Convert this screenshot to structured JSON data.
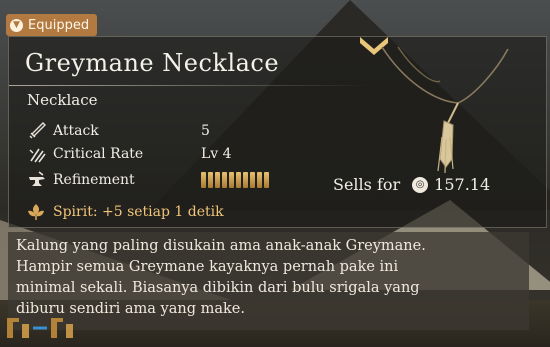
{
  "tag": {
    "label": "Equipped",
    "icon": "equipped-shield-icon"
  },
  "item": {
    "name": "Greymane Necklace",
    "type": "Necklace",
    "icon": "necklace-art"
  },
  "stats": [
    {
      "name": "Attack",
      "value": "5",
      "icon": "sword-icon"
    },
    {
      "name": "Critical Rate",
      "value": "Lv 4",
      "icon": "crit-slash-icon"
    },
    {
      "name": "Refinement",
      "value": "",
      "icon": "anvil-icon"
    }
  ],
  "refinement": {
    "level": 10,
    "max": 10
  },
  "sell": {
    "label": "Sells for",
    "price": "157.14",
    "currency_icon": "coin-icon"
  },
  "spirit": {
    "text": "Spirit: +5 setiap 1 detik",
    "icon": "spirit-leaf-icon"
  },
  "description": [
    "Kalung yang paling disukain ama anak-anak Greymane.",
    "Hampir semua Greymane kayaknya pernah pake ini",
    "minimal sekali. Biasanya dibikin dari bulu srigala yang",
    "diburu sendiri ama yang make."
  ],
  "colors": {
    "accent": "#b27a40",
    "spirit": "#f1c57a",
    "refine": "#e8c170"
  }
}
